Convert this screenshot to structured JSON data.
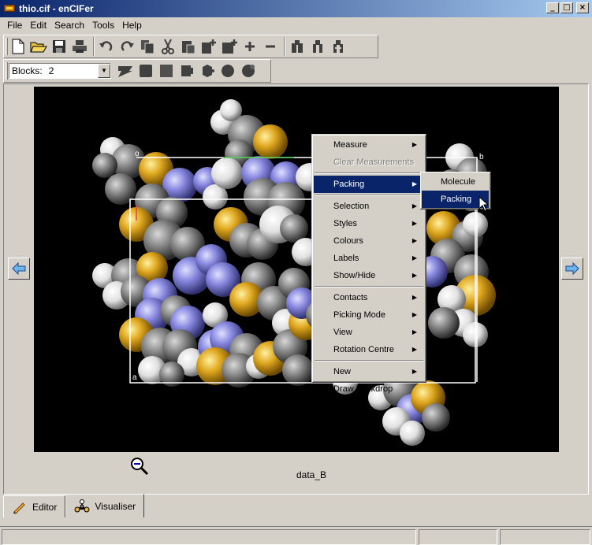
{
  "window": {
    "title": "thio.cif - enCIFer",
    "buttons": [
      "_",
      "□",
      "×"
    ]
  },
  "menubar": {
    "items": [
      "File",
      "Edit",
      "Search",
      "Tools",
      "Help"
    ]
  },
  "toolbar": {
    "icons": [
      "new-file-icon",
      "open-folder-icon",
      "save-icon",
      "print-icon",
      "undo-icon",
      "redo-icon",
      "copy-icon",
      "cut-icon",
      "paste-icon",
      "add-loop-icon",
      "add-item-icon",
      "plus-icon",
      "minus-icon",
      "find-icon",
      "find-next-icon",
      "find-previous-icon"
    ]
  },
  "toolbar2": {
    "blocks_label": "Blocks:",
    "blocks_value": "2",
    "icons": [
      "structure-icon",
      "cell-icon",
      "block-icon",
      "packing-icon",
      "molecule-icon",
      "sphere-icon",
      "sphere-alt-icon"
    ]
  },
  "viewer": {
    "axis_labels": {
      "a": "a",
      "b": "b",
      "o": "o"
    },
    "dataset_label": "data_B"
  },
  "context_menu": {
    "items": [
      {
        "label": "Measure",
        "submenu": true,
        "disabled": false
      },
      {
        "label": "Clear Measurements",
        "submenu": false,
        "disabled": true
      },
      {
        "label": "Packing",
        "submenu": true,
        "selected": true
      },
      {
        "label": "Selection",
        "submenu": true
      },
      {
        "label": "Styles",
        "submenu": true
      },
      {
        "label": "Colours",
        "submenu": true
      },
      {
        "label": "Labels",
        "submenu": true
      },
      {
        "label": "Show/Hide",
        "submenu": true
      },
      {
        "label": "Contacts",
        "submenu": true
      },
      {
        "label": "Picking Mode",
        "submenu": true
      },
      {
        "label": "View",
        "submenu": true
      },
      {
        "label": "Rotation Centre",
        "submenu": true
      },
      {
        "label": "New",
        "submenu": true
      },
      {
        "label": "Draw Backdrop",
        "submenu": false
      }
    ],
    "submenu": {
      "items": [
        "Molecule",
        "Packing"
      ],
      "selected": "Packing"
    }
  },
  "tabs": [
    {
      "label": "Editor",
      "active": false
    },
    {
      "label": "Visualiser",
      "active": true
    }
  ],
  "colors": {
    "selection": "#0a246a",
    "carbon": "#7a7a7a",
    "sulfur": "#e8b020",
    "nitrogen": "#8080e0",
    "hydrogen": "#e8e8e8"
  }
}
